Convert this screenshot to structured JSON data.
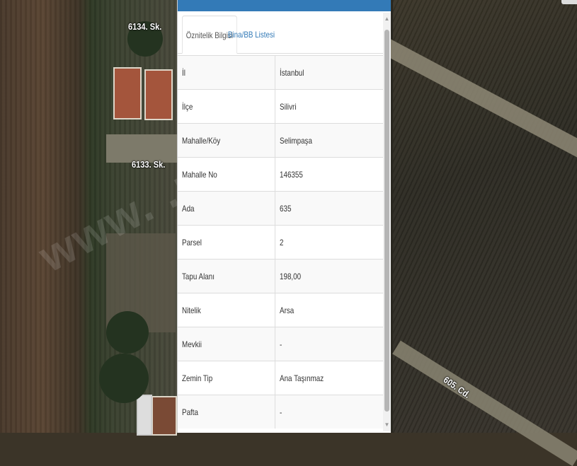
{
  "map": {
    "labels": [
      "6134. Sk.",
      "6133. Sk.",
      "605. Cd."
    ],
    "watermark": "www.                .net.tr"
  },
  "panel": {
    "tabs": [
      {
        "label": "Öznitelik Bilgisi",
        "active": true
      },
      {
        "label": "Bina/BB Listesi",
        "active": false
      }
    ],
    "rows": [
      {
        "key": "İl",
        "value": "İstanbul"
      },
      {
        "key": "İlçe",
        "value": "Silivri"
      },
      {
        "key": "Mahalle/Köy",
        "value": "Selimpaşa"
      },
      {
        "key": "Mahalle No",
        "value": "146355"
      },
      {
        "key": "Ada",
        "value": "635"
      },
      {
        "key": "Parsel",
        "value": "2"
      },
      {
        "key": "Tapu Alanı",
        "value": "198,00"
      },
      {
        "key": "Nitelik",
        "value": "Arsa"
      },
      {
        "key": "Mevkii",
        "value": "-"
      },
      {
        "key": "Zemin Tip",
        "value": "Ana Taşınmaz"
      },
      {
        "key": "Pafta",
        "value": "-"
      }
    ]
  },
  "colors": {
    "header": "#337ab7",
    "link": "#337ab7"
  }
}
